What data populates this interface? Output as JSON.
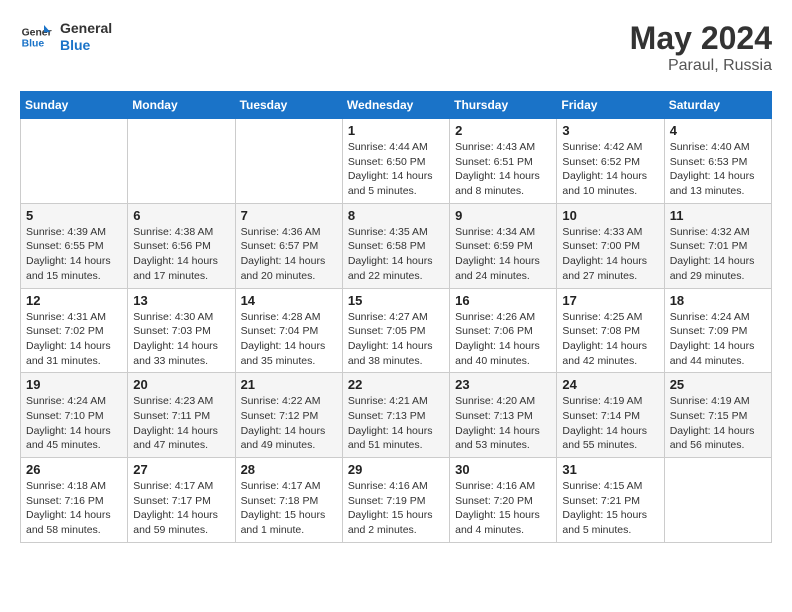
{
  "header": {
    "logo_line1": "General",
    "logo_line2": "Blue",
    "month_year": "May 2024",
    "location": "Paraul, Russia"
  },
  "weekdays": [
    "Sunday",
    "Monday",
    "Tuesday",
    "Wednesday",
    "Thursday",
    "Friday",
    "Saturday"
  ],
  "weeks": [
    [
      {
        "day": "",
        "info": ""
      },
      {
        "day": "",
        "info": ""
      },
      {
        "day": "",
        "info": ""
      },
      {
        "day": "1",
        "info": "Sunrise: 4:44 AM\nSunset: 6:50 PM\nDaylight: 14 hours\nand 5 minutes."
      },
      {
        "day": "2",
        "info": "Sunrise: 4:43 AM\nSunset: 6:51 PM\nDaylight: 14 hours\nand 8 minutes."
      },
      {
        "day": "3",
        "info": "Sunrise: 4:42 AM\nSunset: 6:52 PM\nDaylight: 14 hours\nand 10 minutes."
      },
      {
        "day": "4",
        "info": "Sunrise: 4:40 AM\nSunset: 6:53 PM\nDaylight: 14 hours\nand 13 minutes."
      }
    ],
    [
      {
        "day": "5",
        "info": "Sunrise: 4:39 AM\nSunset: 6:55 PM\nDaylight: 14 hours\nand 15 minutes."
      },
      {
        "day": "6",
        "info": "Sunrise: 4:38 AM\nSunset: 6:56 PM\nDaylight: 14 hours\nand 17 minutes."
      },
      {
        "day": "7",
        "info": "Sunrise: 4:36 AM\nSunset: 6:57 PM\nDaylight: 14 hours\nand 20 minutes."
      },
      {
        "day": "8",
        "info": "Sunrise: 4:35 AM\nSunset: 6:58 PM\nDaylight: 14 hours\nand 22 minutes."
      },
      {
        "day": "9",
        "info": "Sunrise: 4:34 AM\nSunset: 6:59 PM\nDaylight: 14 hours\nand 24 minutes."
      },
      {
        "day": "10",
        "info": "Sunrise: 4:33 AM\nSunset: 7:00 PM\nDaylight: 14 hours\nand 27 minutes."
      },
      {
        "day": "11",
        "info": "Sunrise: 4:32 AM\nSunset: 7:01 PM\nDaylight: 14 hours\nand 29 minutes."
      }
    ],
    [
      {
        "day": "12",
        "info": "Sunrise: 4:31 AM\nSunset: 7:02 PM\nDaylight: 14 hours\nand 31 minutes."
      },
      {
        "day": "13",
        "info": "Sunrise: 4:30 AM\nSunset: 7:03 PM\nDaylight: 14 hours\nand 33 minutes."
      },
      {
        "day": "14",
        "info": "Sunrise: 4:28 AM\nSunset: 7:04 PM\nDaylight: 14 hours\nand 35 minutes."
      },
      {
        "day": "15",
        "info": "Sunrise: 4:27 AM\nSunset: 7:05 PM\nDaylight: 14 hours\nand 38 minutes."
      },
      {
        "day": "16",
        "info": "Sunrise: 4:26 AM\nSunset: 7:06 PM\nDaylight: 14 hours\nand 40 minutes."
      },
      {
        "day": "17",
        "info": "Sunrise: 4:25 AM\nSunset: 7:08 PM\nDaylight: 14 hours\nand 42 minutes."
      },
      {
        "day": "18",
        "info": "Sunrise: 4:24 AM\nSunset: 7:09 PM\nDaylight: 14 hours\nand 44 minutes."
      }
    ],
    [
      {
        "day": "19",
        "info": "Sunrise: 4:24 AM\nSunset: 7:10 PM\nDaylight: 14 hours\nand 45 minutes."
      },
      {
        "day": "20",
        "info": "Sunrise: 4:23 AM\nSunset: 7:11 PM\nDaylight: 14 hours\nand 47 minutes."
      },
      {
        "day": "21",
        "info": "Sunrise: 4:22 AM\nSunset: 7:12 PM\nDaylight: 14 hours\nand 49 minutes."
      },
      {
        "day": "22",
        "info": "Sunrise: 4:21 AM\nSunset: 7:13 PM\nDaylight: 14 hours\nand 51 minutes."
      },
      {
        "day": "23",
        "info": "Sunrise: 4:20 AM\nSunset: 7:13 PM\nDaylight: 14 hours\nand 53 minutes."
      },
      {
        "day": "24",
        "info": "Sunrise: 4:19 AM\nSunset: 7:14 PM\nDaylight: 14 hours\nand 55 minutes."
      },
      {
        "day": "25",
        "info": "Sunrise: 4:19 AM\nSunset: 7:15 PM\nDaylight: 14 hours\nand 56 minutes."
      }
    ],
    [
      {
        "day": "26",
        "info": "Sunrise: 4:18 AM\nSunset: 7:16 PM\nDaylight: 14 hours\nand 58 minutes."
      },
      {
        "day": "27",
        "info": "Sunrise: 4:17 AM\nSunset: 7:17 PM\nDaylight: 14 hours\nand 59 minutes."
      },
      {
        "day": "28",
        "info": "Sunrise: 4:17 AM\nSunset: 7:18 PM\nDaylight: 15 hours\nand 1 minute."
      },
      {
        "day": "29",
        "info": "Sunrise: 4:16 AM\nSunset: 7:19 PM\nDaylight: 15 hours\nand 2 minutes."
      },
      {
        "day": "30",
        "info": "Sunrise: 4:16 AM\nSunset: 7:20 PM\nDaylight: 15 hours\nand 4 minutes."
      },
      {
        "day": "31",
        "info": "Sunrise: 4:15 AM\nSunset: 7:21 PM\nDaylight: 15 hours\nand 5 minutes."
      },
      {
        "day": "",
        "info": ""
      }
    ]
  ]
}
